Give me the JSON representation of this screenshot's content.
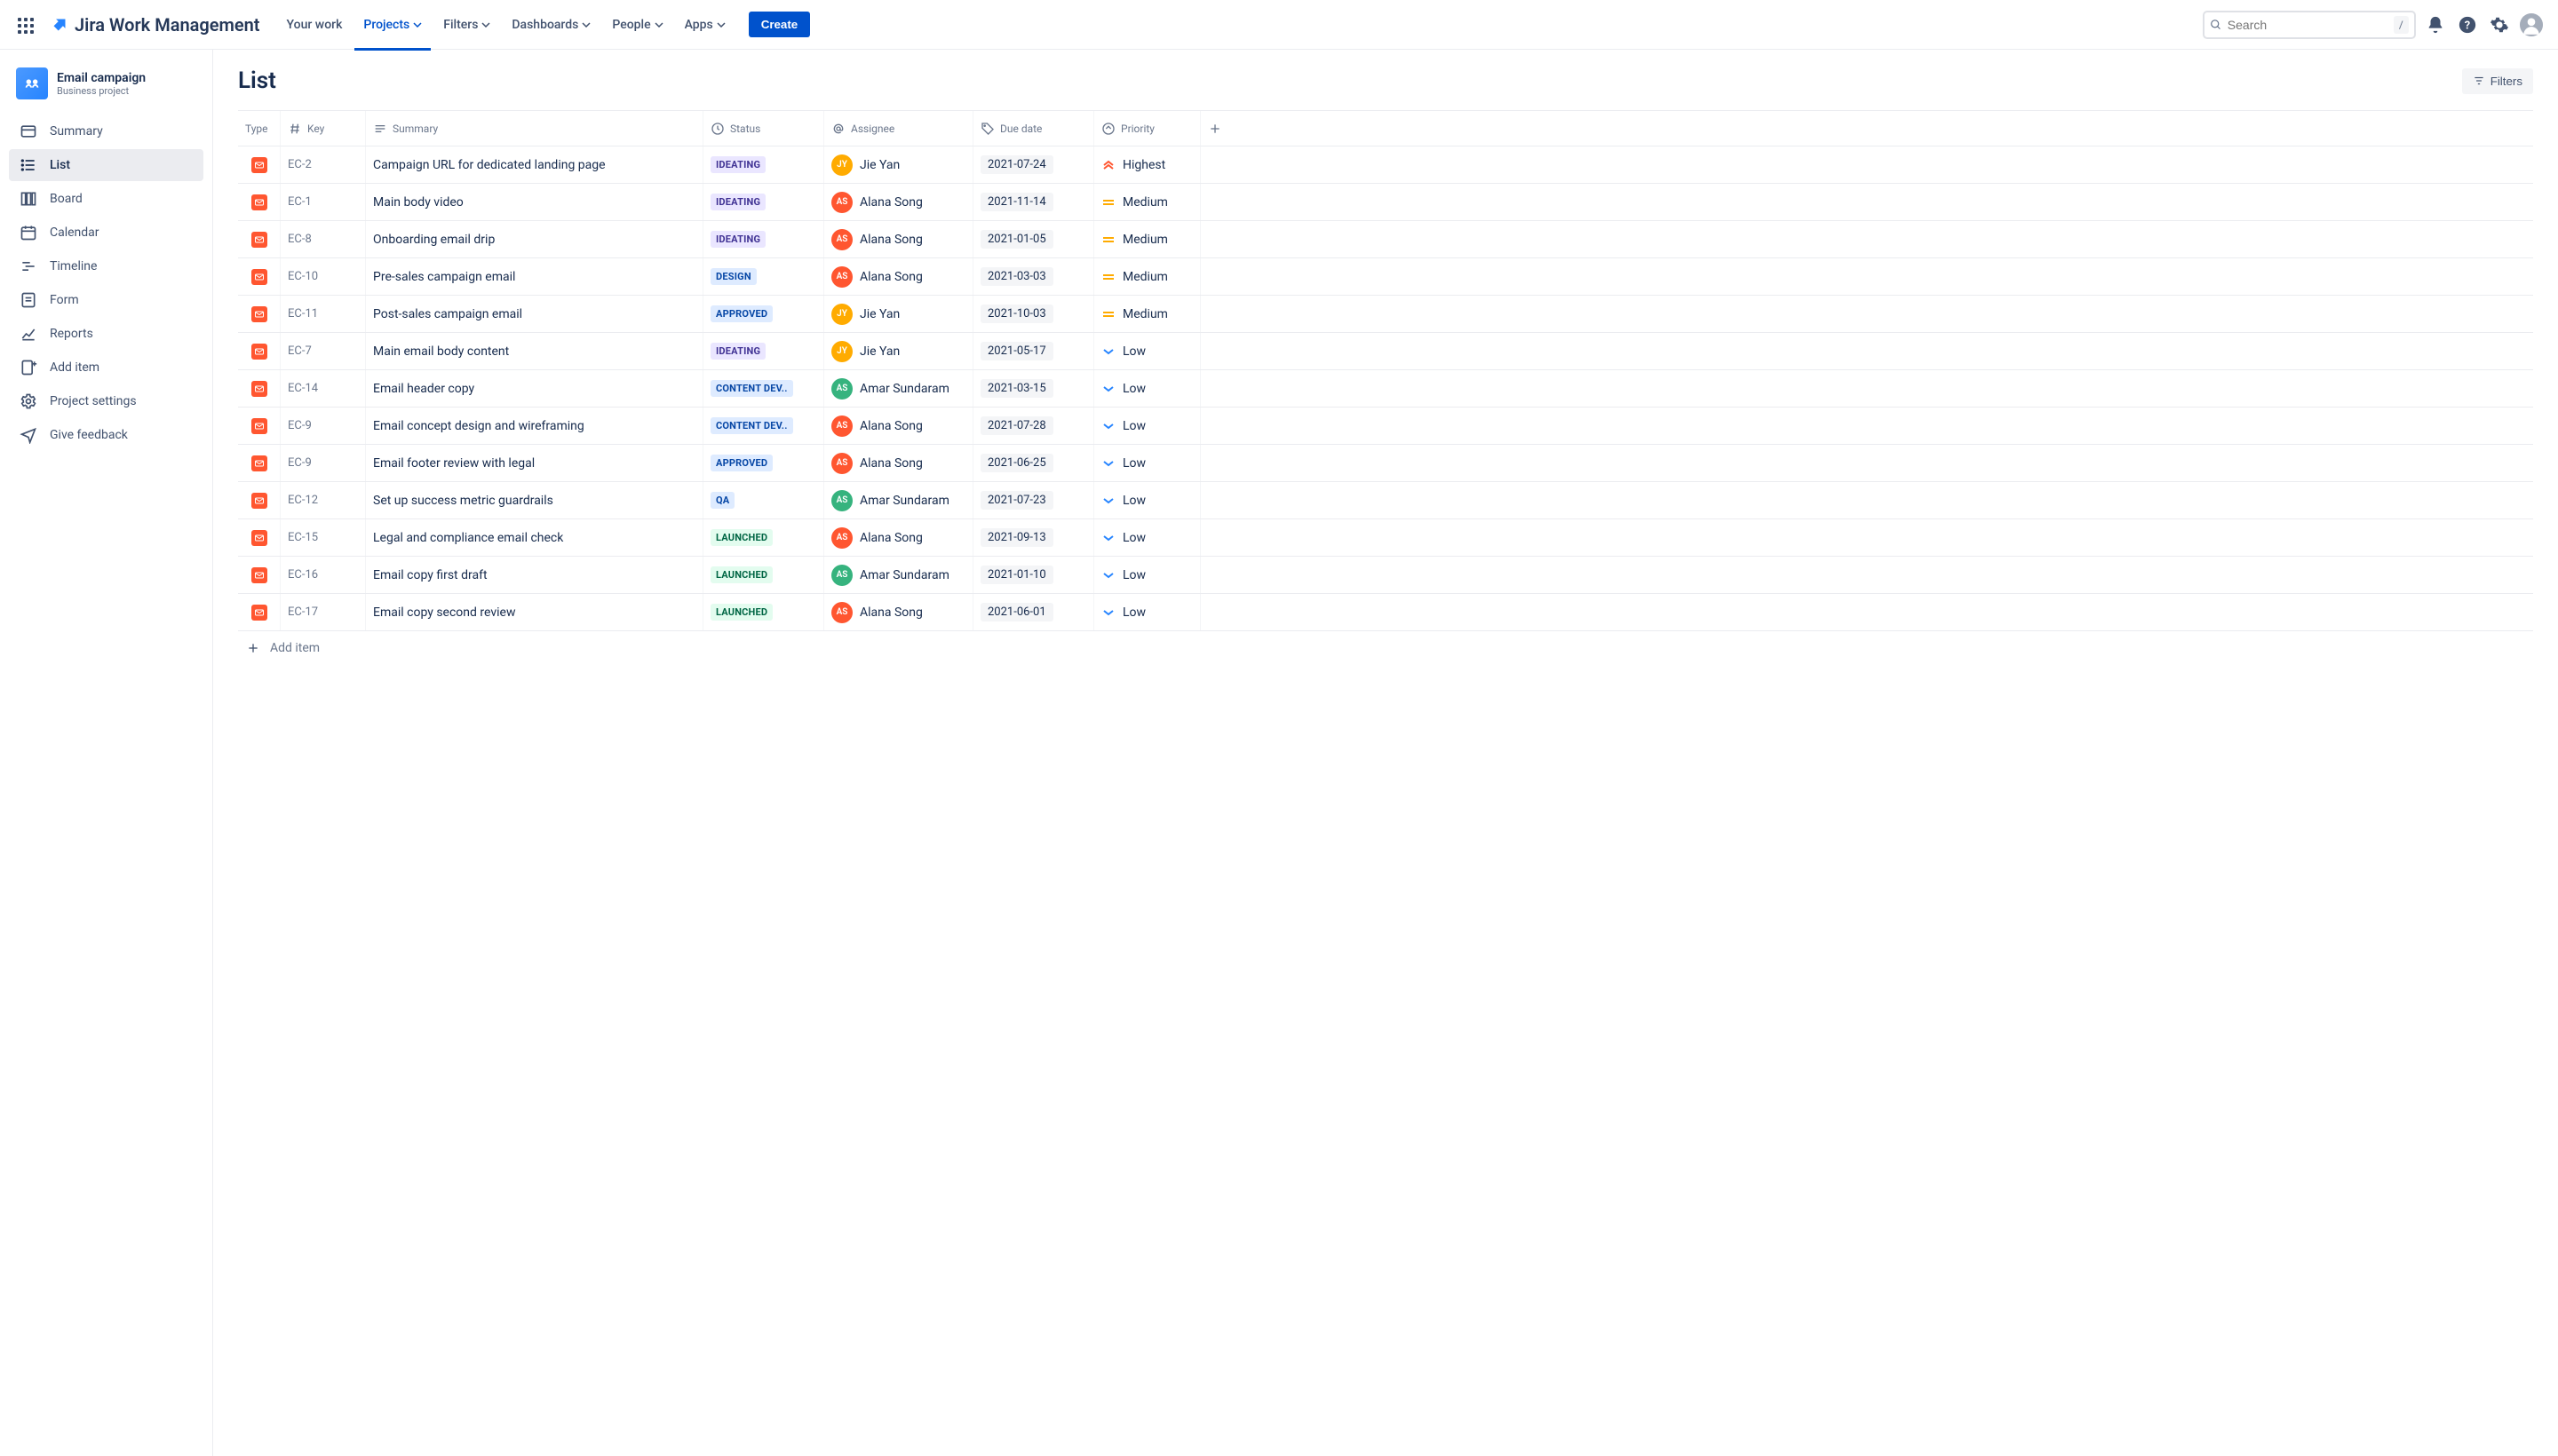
{
  "app_name": "Jira Work Management",
  "topnav": {
    "items": [
      "Your work",
      "Projects",
      "Filters",
      "Dashboards",
      "People",
      "Apps"
    ],
    "active_index": 1,
    "create_label": "Create",
    "search_placeholder": "Search",
    "search_shortcut": "/"
  },
  "project": {
    "name": "Email campaign",
    "subtitle": "Business project"
  },
  "sidebar": {
    "items": [
      {
        "label": "Summary",
        "icon": "summary-icon"
      },
      {
        "label": "List",
        "icon": "list-icon"
      },
      {
        "label": "Board",
        "icon": "board-icon"
      },
      {
        "label": "Calendar",
        "icon": "calendar-icon"
      },
      {
        "label": "Timeline",
        "icon": "timeline-icon"
      },
      {
        "label": "Form",
        "icon": "form-icon"
      },
      {
        "label": "Reports",
        "icon": "reports-icon"
      },
      {
        "label": "Add item",
        "icon": "add-item-icon"
      },
      {
        "label": "Project settings",
        "icon": "settings-icon"
      },
      {
        "label": "Give feedback",
        "icon": "feedback-icon"
      }
    ],
    "active_index": 1
  },
  "page": {
    "title": "List",
    "filters_label": "Filters",
    "add_item_label": "Add item"
  },
  "columns": [
    "Type",
    "Key",
    "Summary",
    "Status",
    "Assignee",
    "Due date",
    "Priority"
  ],
  "status_colors": {
    "IDEATING": {
      "bg": "#EAE6FF",
      "fg": "#403294"
    },
    "DESIGN": {
      "bg": "#DEEBFF",
      "fg": "#0747A6"
    },
    "APPROVED": {
      "bg": "#DEEBFF",
      "fg": "#0747A6"
    },
    "CONTENT DEV..": {
      "bg": "#DEEBFF",
      "fg": "#0747A6"
    },
    "QA": {
      "bg": "#DEEBFF",
      "fg": "#0747A6"
    },
    "LAUNCHED": {
      "bg": "#E3FCEF",
      "fg": "#006644"
    }
  },
  "assignee_colors": {
    "Jie Yan": "#FFAB00",
    "Alana Song": "#FF5630",
    "Amar Sundaram": "#36B37E"
  },
  "priority_meta": {
    "Highest": {
      "color": "#FF5630",
      "double": true,
      "up": true
    },
    "Medium": {
      "color": "#FFAB00",
      "double": true,
      "up": false,
      "flat": true
    },
    "Low": {
      "color": "#2684FF",
      "double": false,
      "up": false
    }
  },
  "rows": [
    {
      "key": "EC-2",
      "summary": "Campaign URL for dedicated landing page",
      "status": "IDEATING",
      "assignee": "Jie Yan",
      "due": "2021-07-24",
      "priority": "Highest"
    },
    {
      "key": "EC-1",
      "summary": "Main body video",
      "status": "IDEATING",
      "assignee": "Alana Song",
      "due": "2021-11-14",
      "priority": "Medium"
    },
    {
      "key": "EC-8",
      "summary": "Onboarding email drip",
      "status": "IDEATING",
      "assignee": "Alana Song",
      "due": "2021-01-05",
      "priority": "Medium"
    },
    {
      "key": "EC-10",
      "summary": "Pre-sales campaign email",
      "status": "DESIGN",
      "assignee": "Alana Song",
      "due": "2021-03-03",
      "priority": "Medium"
    },
    {
      "key": "EC-11",
      "summary": "Post-sales campaign email",
      "status": "APPROVED",
      "assignee": "Jie Yan",
      "due": "2021-10-03",
      "priority": "Medium"
    },
    {
      "key": "EC-7",
      "summary": "Main email body content",
      "status": "IDEATING",
      "assignee": "Jie Yan",
      "due": "2021-05-17",
      "priority": "Low"
    },
    {
      "key": "EC-14",
      "summary": "Email header copy",
      "status": "CONTENT DEV..",
      "assignee": "Amar Sundaram",
      "due": "2021-03-15",
      "priority": "Low"
    },
    {
      "key": "EC-9",
      "summary": "Email concept design and wireframing",
      "status": "CONTENT DEV..",
      "assignee": "Alana Song",
      "due": "2021-07-28",
      "priority": "Low"
    },
    {
      "key": "EC-9",
      "summary": "Email footer review with legal",
      "status": "APPROVED",
      "assignee": "Alana Song",
      "due": "2021-06-25",
      "priority": "Low"
    },
    {
      "key": "EC-12",
      "summary": "Set up success metric guardrails",
      "status": "QA",
      "assignee": "Amar Sundaram",
      "due": "2021-07-23",
      "priority": "Low"
    },
    {
      "key": "EC-15",
      "summary": "Legal and compliance email check",
      "status": "LAUNCHED",
      "assignee": "Alana Song",
      "due": "2021-09-13",
      "priority": "Low"
    },
    {
      "key": "EC-16",
      "summary": "Email copy first draft",
      "status": "LAUNCHED",
      "assignee": "Amar Sundaram",
      "due": "2021-01-10",
      "priority": "Low"
    },
    {
      "key": "EC-17",
      "summary": "Email copy second review",
      "status": "LAUNCHED",
      "assignee": "Alana Song",
      "due": "2021-06-01",
      "priority": "Low"
    }
  ]
}
